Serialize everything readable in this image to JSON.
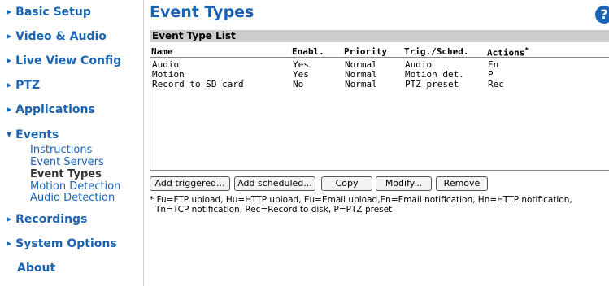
{
  "sidebar": {
    "items": [
      {
        "label": "Basic Setup"
      },
      {
        "label": "Video & Audio"
      },
      {
        "label": "Live View Config"
      },
      {
        "label": "PTZ"
      },
      {
        "label": "Applications"
      },
      {
        "label": "Events"
      },
      {
        "label": "Recordings"
      },
      {
        "label": "System Options"
      },
      {
        "label": "About"
      }
    ],
    "events_sub": [
      {
        "label": "Instructions"
      },
      {
        "label": "Event Servers"
      },
      {
        "label": "Event Types"
      },
      {
        "label": "Motion Detection"
      },
      {
        "label": "Audio Detection"
      }
    ]
  },
  "main": {
    "title": "Event Types",
    "help": "?",
    "section": "Event Type List",
    "columns": {
      "name": "Name",
      "enabled": "Enabl.",
      "priority": "Priority",
      "trigger": "Trig./Sched.",
      "actions": "Actions",
      "actions_mark": "*"
    },
    "rows": [
      {
        "name": "Audio",
        "enabled": "Yes",
        "priority": "Normal",
        "trigger": "Audio",
        "actions": "En"
      },
      {
        "name": "Motion",
        "enabled": "Yes",
        "priority": "Normal",
        "trigger": "Motion det.",
        "actions": "P"
      },
      {
        "name": "Record to SD card",
        "enabled": "No",
        "priority": "Normal",
        "trigger": "PTZ preset",
        "actions": "Rec"
      }
    ],
    "buttons": {
      "add_triggered": "Add triggered...",
      "add_scheduled": "Add scheduled...",
      "copy": "Copy",
      "modify": "Modify...",
      "remove": "Remove"
    },
    "footnote": {
      "line1": "* Fu=FTP upload, Hu=HTTP upload, Eu=Email upload,En=Email notification, Hn=HTTP notification,",
      "line2": "Tn=TCP notification, Rec=Record to disk, P=PTZ preset"
    }
  }
}
